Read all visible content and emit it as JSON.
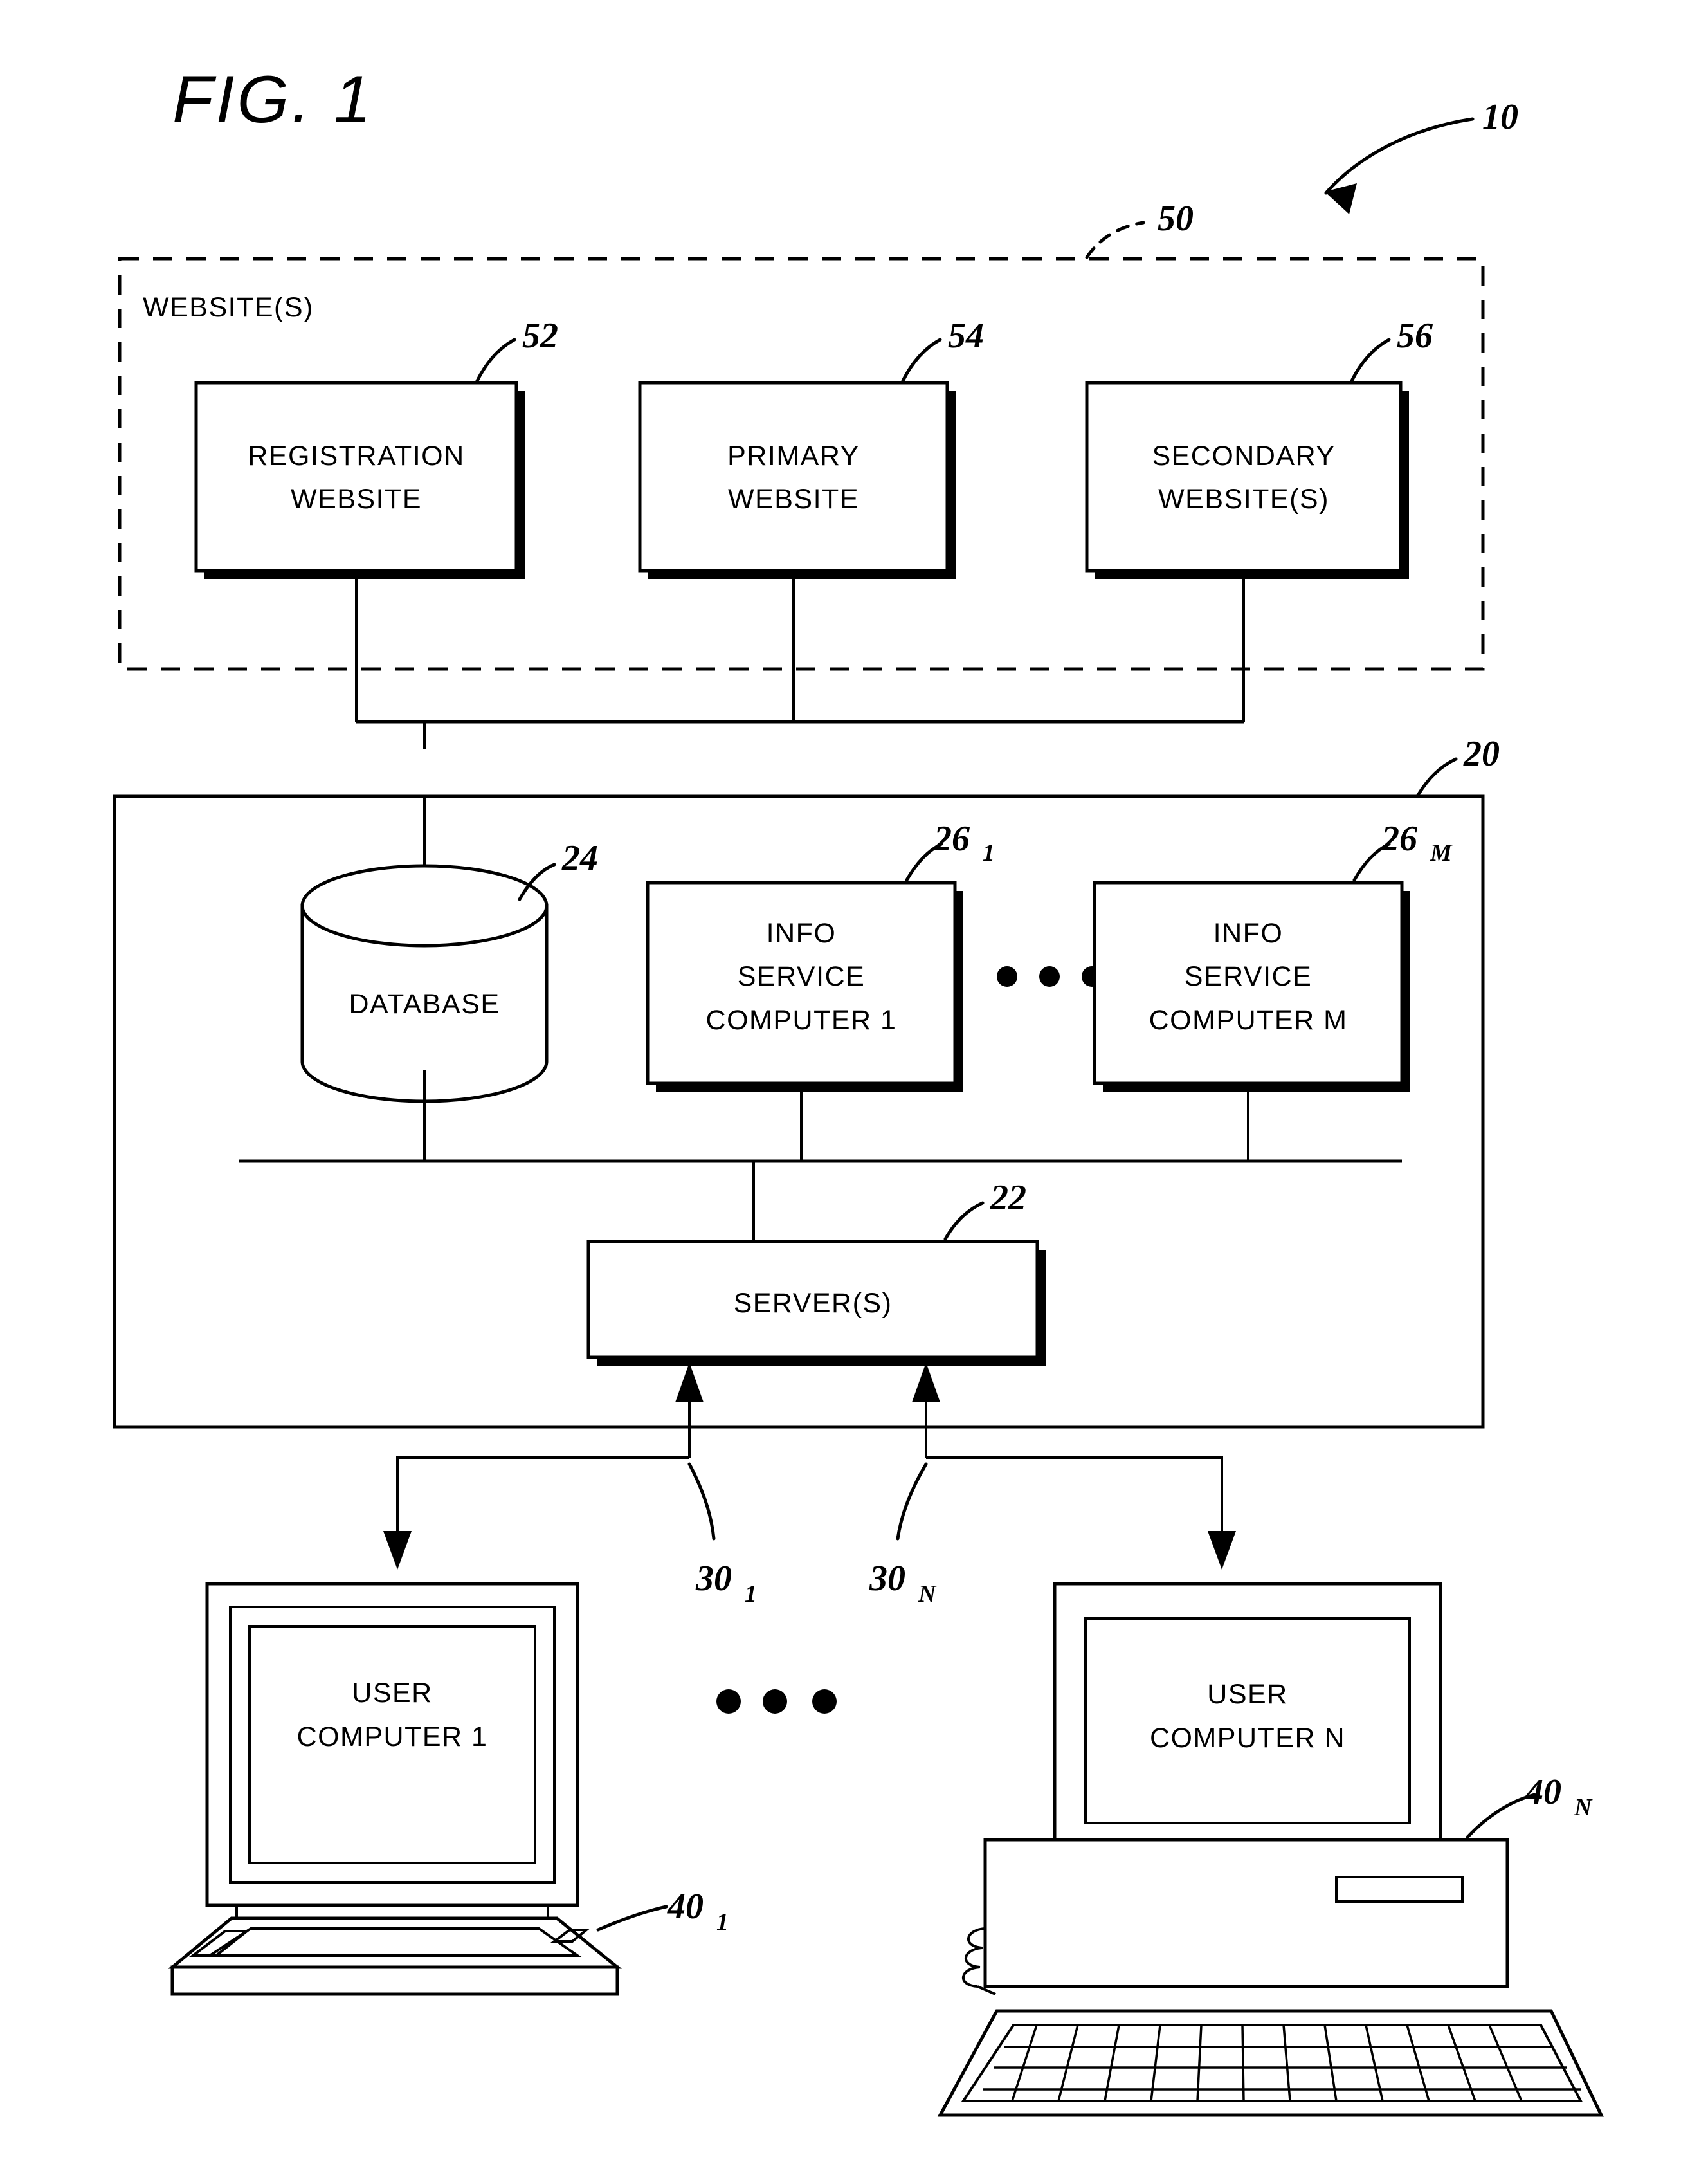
{
  "figure": {
    "title": "FIG. 1",
    "system_ref": "10"
  },
  "websites_group": {
    "label": "WEBSITE(S)",
    "ref": "50",
    "boxes": [
      {
        "line1": "REGISTRATION",
        "line2": "WEBSITE",
        "ref": "52",
        "ref_sub": ""
      },
      {
        "line1": "PRIMARY",
        "line2": "WEBSITE",
        "ref": "54",
        "ref_sub": ""
      },
      {
        "line1": "SECONDARY",
        "line2": "WEBSITE(S)",
        "ref": "56",
        "ref_sub": ""
      }
    ]
  },
  "system_group": {
    "ref": "20",
    "database": {
      "label": "DATABASE",
      "ref": "24"
    },
    "info_services": [
      {
        "line1": "INFO",
        "line2": "SERVICE",
        "line3": "COMPUTER  1",
        "ref": "26",
        "ref_sub": "1"
      },
      {
        "line1": "INFO",
        "line2": "SERVICE",
        "line3": "COMPUTER  M",
        "ref": "26",
        "ref_sub": "M"
      }
    ],
    "info_services_ellipsis": "• • •",
    "server": {
      "label": "SERVER(S)",
      "ref": "22"
    }
  },
  "connections": [
    {
      "ref": "30",
      "ref_sub": "1"
    },
    {
      "ref": "30",
      "ref_sub": "N"
    }
  ],
  "user_computers": [
    {
      "line1": "USER",
      "line2": "COMPUTER  1",
      "ref": "40",
      "ref_sub": "1",
      "kind": "laptop"
    },
    {
      "line1": "USER",
      "line2": "COMPUTER  N",
      "ref": "40",
      "ref_sub": "N",
      "kind": "desktop"
    }
  ],
  "user_computers_ellipsis": "• • •",
  "colors": {
    "ink": "#000000",
    "paper": "#ffffff"
  }
}
